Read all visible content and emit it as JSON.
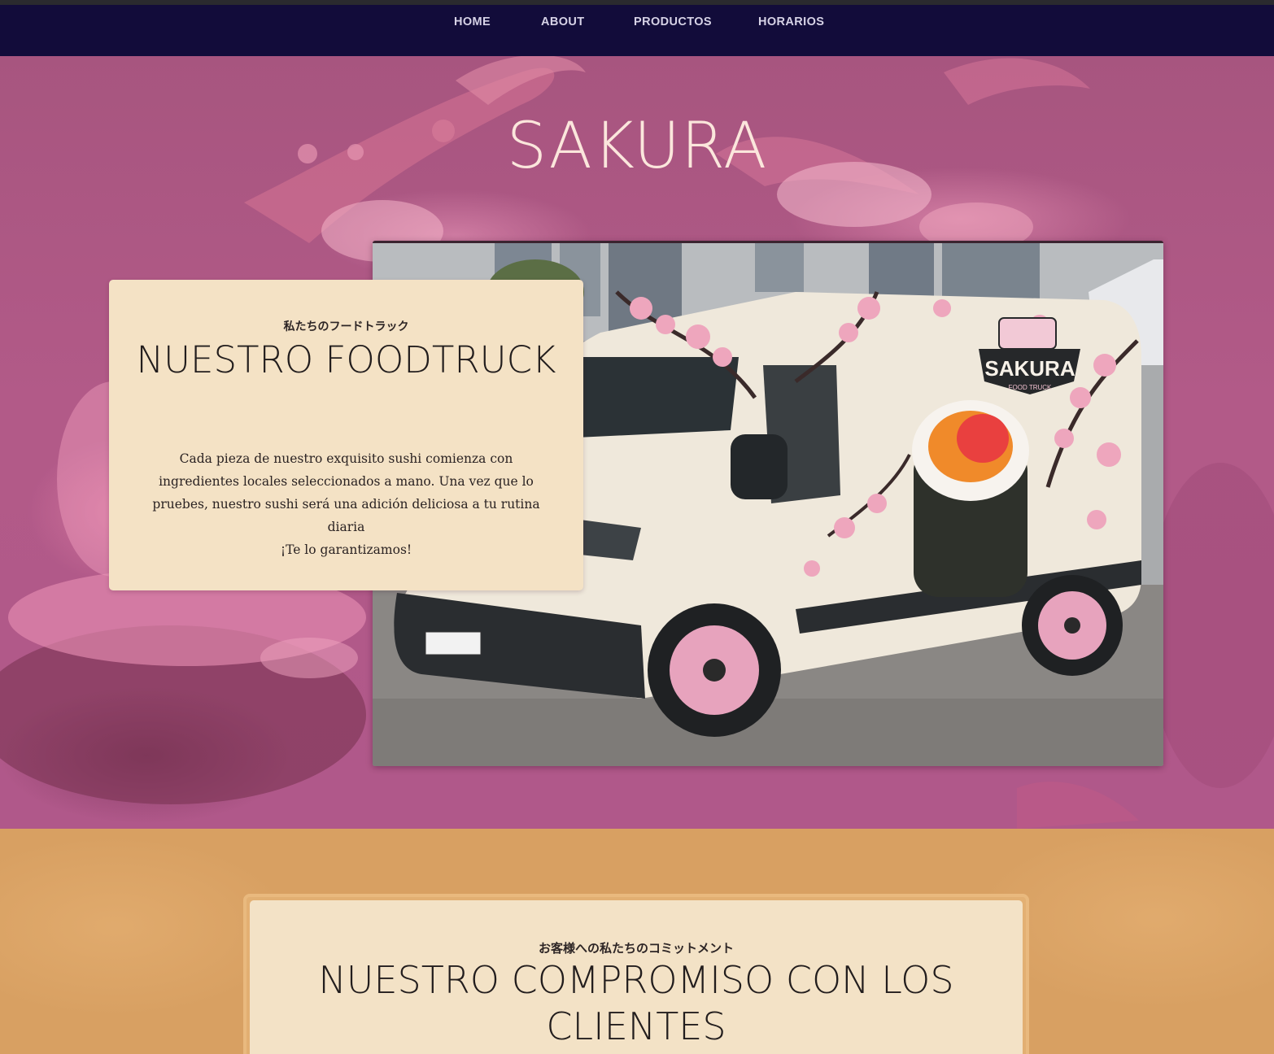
{
  "nav": {
    "items": [
      {
        "label": "HOME"
      },
      {
        "label": "ABOUT"
      },
      {
        "label": "PRODUCTOS"
      },
      {
        "label": "HORARIOS"
      }
    ]
  },
  "hero": {
    "title": "SAKURA",
    "truck_image": {
      "alt": "Sakura food truck van decorated with cherry blossoms and a sushi roll",
      "logo_text": "SAKURA",
      "logo_subtext": "FOOD TRUCK"
    }
  },
  "about": {
    "subtitle": "私たちのフードトラック",
    "title": "NUESTRO FOODTRUCK",
    "text": "Cada pieza de nuestro exquisito sushi comienza con ingredientes locales seleccionados a mano. Una vez que lo pruebes, nuestro sushi será una adición deliciosa a tu rutina diaria",
    "text_tagline": "¡Te lo garantizamos!"
  },
  "commitment": {
    "subtitle": "お客様への私たちのコミットメント",
    "title": "NUESTRO COMPROMISO CON LOS CLIENTES"
  },
  "colors": {
    "nav_bg": "#120c3a",
    "hero_bg": "#b0588a",
    "card_bg": "#f4e2c5",
    "lower_bg": "#d8a062"
  }
}
